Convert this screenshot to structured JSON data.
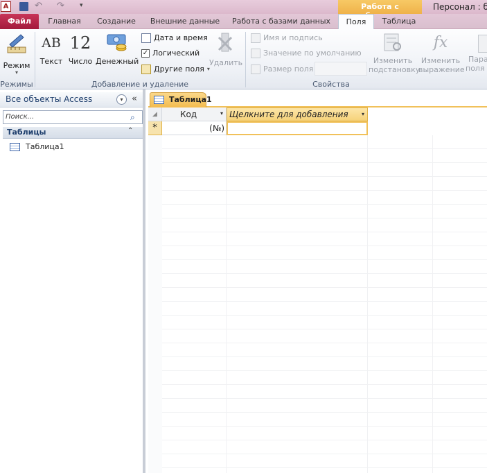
{
  "window": {
    "contextual_title": "Работа с таблицами",
    "app_title": "Персонал : ба"
  },
  "tabs": {
    "file": "Файл",
    "home": "Главная",
    "create": "Создание",
    "external": "Внешние данные",
    "db_tools": "Работа с базами данных",
    "fields": "Поля",
    "table": "Таблица"
  },
  "ribbon": {
    "views_btn": "Режим",
    "views_group": "Режимы",
    "text_btn": "Текст",
    "number_btn": "Число",
    "currency_btn": "Денежный",
    "text_glyph": "AB",
    "number_glyph": "12",
    "datetime": "Дата и время",
    "boolean": "Логический",
    "more_fields": "Другие поля",
    "delete": "Удалить",
    "add_delete_group": "Добавление и удаление",
    "name_caption": "Имя и подпись",
    "default_value": "Значение по умолчанию",
    "field_size": "Размер поля",
    "modify_lookups_1": "Изменить",
    "modify_lookups_2": "подстановку",
    "modify_expr_1": "Изменить",
    "modify_expr_2": "выражение",
    "params_1": "Пара",
    "params_2": "поля I",
    "fx_glyph": "fx",
    "properties_group": "Свойства"
  },
  "nav": {
    "title": "Все объекты Access",
    "search_placeholder": "Поиск...",
    "section": "Таблицы",
    "items": [
      "Таблица1"
    ]
  },
  "doc": {
    "tab": "Таблица1",
    "col_id": "Код",
    "col_add": "Щелкните для добавления",
    "new_row_marker": "*",
    "new_row_id": "(№)"
  },
  "colors": {
    "file_tab": "#b21e44",
    "selected_tab_bg": "#fff",
    "contextual": "#f3b84a",
    "grid_selection": "#f1c15a"
  }
}
